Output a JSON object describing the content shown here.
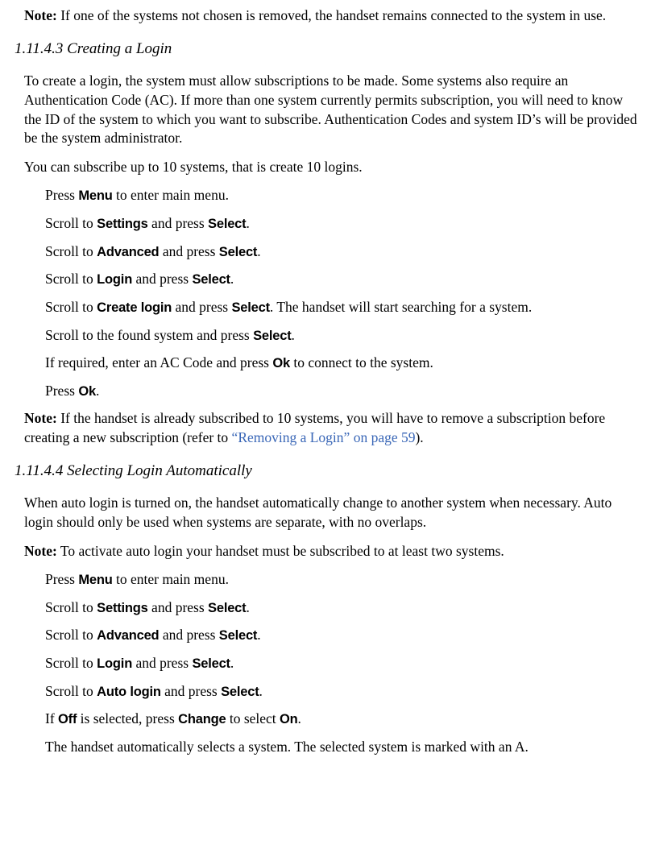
{
  "ui": {
    "menu": "Menu",
    "settings": "Settings",
    "advanced": "Advanced",
    "login": "Login",
    "create_login": "Create login",
    "auto_login": "Auto login",
    "select": "Select",
    "ok": "Ok",
    "off": "Off",
    "on": "On",
    "change": "Change"
  },
  "notes": {
    "label": "Note:",
    "top_note": " If one of the systems not chosen is removed, the handset remains connected to the system in use.",
    "s443_note_body": " If the handset is already subscribed to 10 systems, you will have to remove a subscription before creating a new subscription (refer to ",
    "s443_note_xref": "“Removing a Login” on page 59",
    "s443_note_tail": ").",
    "s444_note": " To activate auto login your handset must be subscribed to at least two systems."
  },
  "s443": {
    "heading_num": "1.11.4.3",
    "heading_title": "  Creating a Login",
    "para1": "To create a login, the system must allow subscriptions to be made. Some systems also require an Authentication Code (AC). If more than one system currently permits subscription, you will need to know the ID of the system to which you want to subscribe. Authentication Codes and system ID’s will be provided be the system administrator.",
    "para2": "You can subscribe up to 10 systems, that is create 10 logins.",
    "steps": {
      "press": "Press ",
      "scroll_to": "Scroll to ",
      "and_press": " and press ",
      "to_enter_main": " to enter main menu.",
      "period": ".",
      "s5_tail": ". The handset will start searching for a system.",
      "s6_a": "Scroll to the found system and press ",
      "s7_a": "If required, enter an AC Code and press ",
      "s7_b": " to connect to the system."
    }
  },
  "s444": {
    "heading_num": "1.11.4.4",
    "heading_title": "  Selecting Login Automatically",
    "para1": "When auto login is turned on, the handset automatically change to another system when necessary. Auto login should only be used when systems are separate, with no overlaps.",
    "steps": {
      "s6_a": "If ",
      "s6_b": " is selected, press ",
      "s6_c": " to select ",
      "s7": "The handset automatically selects a system. The selected system is marked with an A."
    }
  }
}
